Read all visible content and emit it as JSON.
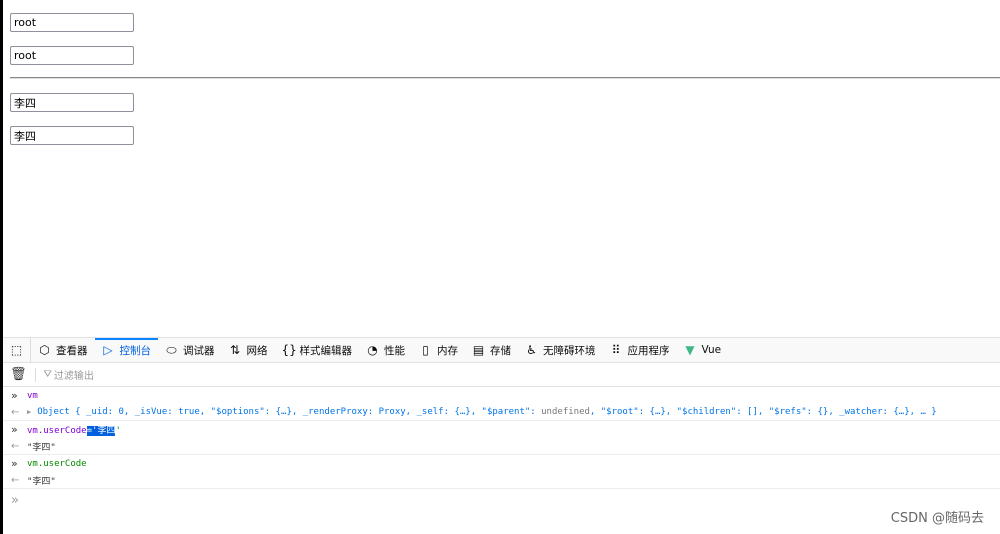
{
  "page": {
    "inputs": [
      "root",
      "root",
      "李四",
      "李四"
    ]
  },
  "devtools": {
    "tabs": [
      {
        "label": "查看器",
        "icon": "inspector-icon",
        "glyph": "⬡"
      },
      {
        "label": "控制台",
        "icon": "console-icon",
        "glyph": "▷",
        "selected": true
      },
      {
        "label": "调试器",
        "icon": "debugger-icon",
        "glyph": "⬭"
      },
      {
        "label": "网络",
        "icon": "network-icon",
        "glyph": "⇅"
      },
      {
        "label": "样式编辑器",
        "icon": "style-editor-icon",
        "glyph": "{}"
      },
      {
        "label": "性能",
        "icon": "performance-icon",
        "glyph": "◔"
      },
      {
        "label": "内存",
        "icon": "memory-icon",
        "glyph": "▯"
      },
      {
        "label": "存储",
        "icon": "storage-icon",
        "glyph": "▤"
      },
      {
        "label": "无障碍环境",
        "icon": "accessibility-icon",
        "glyph": "♿"
      },
      {
        "label": "应用程序",
        "icon": "application-icon",
        "glyph": "⠿"
      },
      {
        "label": "Vue",
        "icon": "vue-icon",
        "glyph": "▼"
      }
    ],
    "filter_placeholder": "过滤输出",
    "console": {
      "cmd1": "vm",
      "obj_prefix": "Object { _uid: 0, _isVue: true, \"$options\": {…}, _renderProxy: Proxy, _self: {…}, \"$parent\": ",
      "obj_undef": "undefined",
      "obj_suffix": ", \"$root\": {…}, \"$children\": [], \"$refs\": {}, _watcher: {…}, … }",
      "cmd2_a": "vm.userCode",
      "cmd2_b": "='李四",
      "cmd2_c": "'",
      "res2": "\"李四\"",
      "cmd3": "vm.userCode",
      "res3": "\"李四\""
    }
  },
  "watermark": "CSDN @随码去",
  "colors": {
    "accent": "#0060df",
    "vue": "#41b883"
  }
}
